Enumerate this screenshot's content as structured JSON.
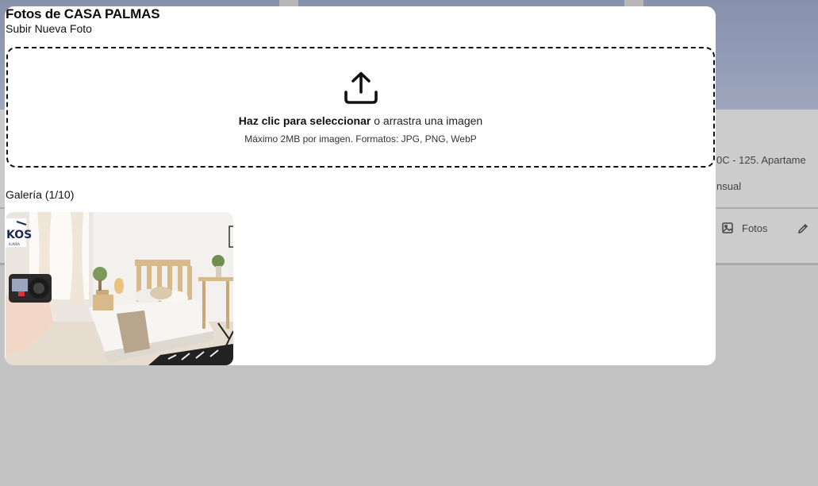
{
  "modal": {
    "title": "Fotos de CASA PALMAS",
    "upload_section_title": "Subir Nueva Foto",
    "dropzone": {
      "icon": "upload-icon",
      "action_text": "Haz clic para seleccionar",
      "drag_text": "o arrastra una imagen",
      "hint": "Máximo 2MB por imagen. Formatos: JPG, PNG, WebP"
    },
    "gallery": {
      "label": "Galería",
      "count": "(1/10)",
      "photos": [
        {
          "description": "Bedroom photo with photographer and camera",
          "watermark_text": "KOS",
          "watermark_subtext": "ILIARIA"
        }
      ]
    }
  },
  "background": {
    "listing_line1": "0C - 125. Apartame",
    "listing_line2": "nsual",
    "photos_button_label": "Fotos",
    "photos_button_icon": "image-icon",
    "edit_icon": "pencil-icon"
  }
}
